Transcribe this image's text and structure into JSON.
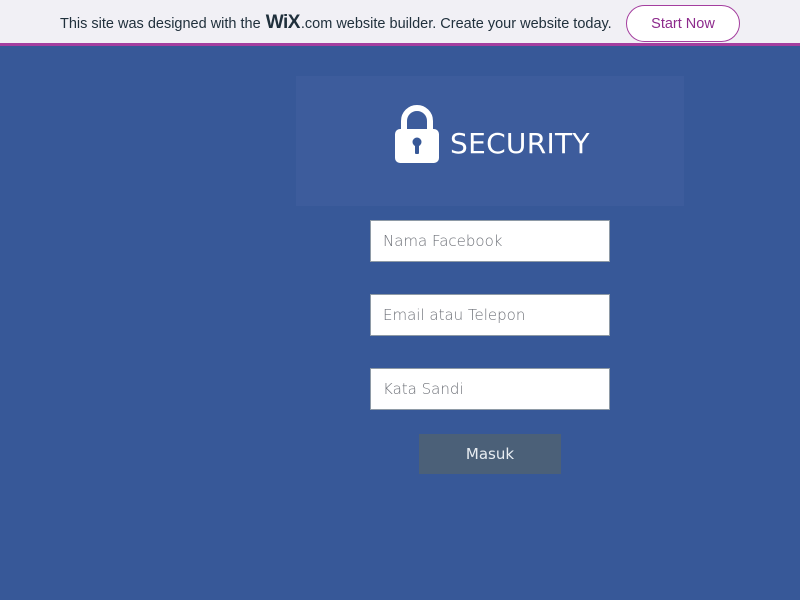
{
  "banner": {
    "text_before": "This site was designed with the",
    "logo": "WiX",
    "logo_suffix": ".com",
    "text_after": "website builder. Create your website today.",
    "cta_label": "Start Now",
    "accent_color": "#a43e9f"
  },
  "security": {
    "icon": "lock-icon",
    "title": "SECURITY"
  },
  "form": {
    "name_placeholder": "Nama Facebook",
    "contact_placeholder": "Email atau Telepon",
    "password_placeholder": "Kata Sandi",
    "submit_label": "Masuk"
  },
  "colors": {
    "page_background": "#375898",
    "button_background": "#4b6078"
  }
}
